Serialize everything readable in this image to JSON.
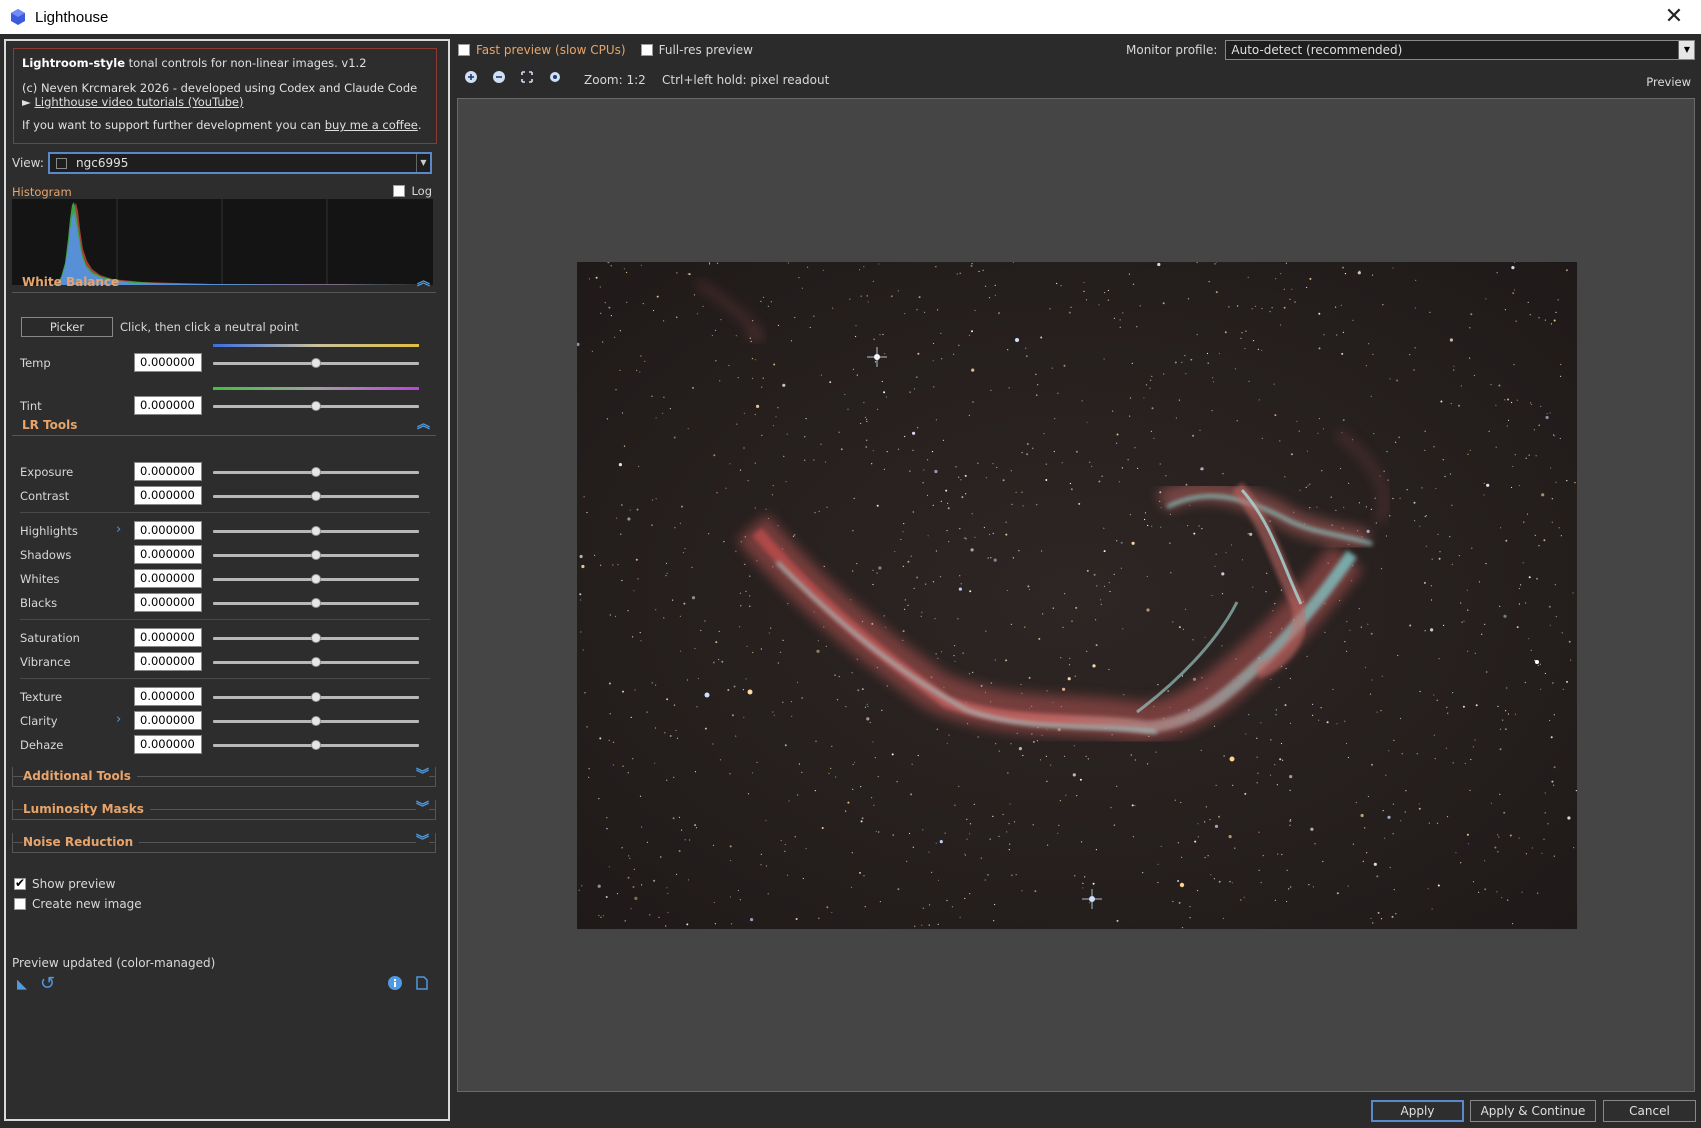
{
  "window": {
    "title": "Lighthouse",
    "close_glyph": "✕",
    "icon": "lighthouse-app-icon"
  },
  "info": {
    "tagline_bold": "Lightroom-style",
    "tagline_rest": " tonal controls for non-linear images. v1.2",
    "credits": "(c) Neven Krcmarek 2026 - developed using Codex and Claude Code",
    "video_prefix": "► ",
    "video_link": "Lighthouse video tutorials (YouTube)",
    "support_prefix": "If you want to support further development you can ",
    "support_link": "buy me a coffee",
    "support_suffix": "."
  },
  "view": {
    "label": "View:",
    "value": "ngc6995"
  },
  "histogram": {
    "label": "Histogram",
    "log_label": "Log",
    "log_checked": false
  },
  "white_balance": {
    "title": "White Balance",
    "picker_label": "Picker",
    "picker_hint": "Click, then click a neutral point",
    "rows": [
      {
        "label": "Temp",
        "value": "0.000000"
      },
      {
        "label": "Tint",
        "value": "0.000000"
      }
    ]
  },
  "lr_tools": {
    "title": "LR Tools",
    "rows": [
      {
        "label": "Exposure",
        "value": "0.000000"
      },
      {
        "label": "Contrast",
        "value": "0.000000"
      },
      {
        "label": "Highlights",
        "value": "0.000000"
      },
      {
        "label": "Shadows",
        "value": "0.000000"
      },
      {
        "label": "Whites",
        "value": "0.000000"
      },
      {
        "label": "Blacks",
        "value": "0.000000"
      },
      {
        "label": "Saturation",
        "value": "0.000000"
      },
      {
        "label": "Vibrance",
        "value": "0.000000"
      },
      {
        "label": "Texture",
        "value": "0.000000"
      },
      {
        "label": "Clarity",
        "value": "0.000000"
      },
      {
        "label": "Dehaze",
        "value": "0.000000"
      }
    ],
    "slider_position": 0.5
  },
  "collapsed_sections": {
    "additional": "Additional Tools",
    "luminosity": "Luminosity Masks",
    "noise": "Noise Reduction"
  },
  "options": {
    "show_preview": "Show preview",
    "show_preview_checked": true,
    "create_new": "Create new image",
    "create_new_checked": false
  },
  "status": "Preview updated (color-managed)",
  "topbar": {
    "fast_preview": "Fast preview (slow CPUs)",
    "full_res": "Full-res preview",
    "monitor_label": "Monitor profile:",
    "monitor_value": "Auto-detect (recommended)"
  },
  "toolbar": {
    "zoom": "Zoom: 1:2",
    "hint": "Ctrl+left hold: pixel readout",
    "preview": "Preview"
  },
  "buttons": {
    "apply": "Apply",
    "apply_continue": "Apply & Continue",
    "cancel": "Cancel"
  },
  "colors": {
    "accent_orange": "#e8a46a",
    "accent_blue": "#4f9ae0",
    "info_border": "#8c3a30"
  }
}
